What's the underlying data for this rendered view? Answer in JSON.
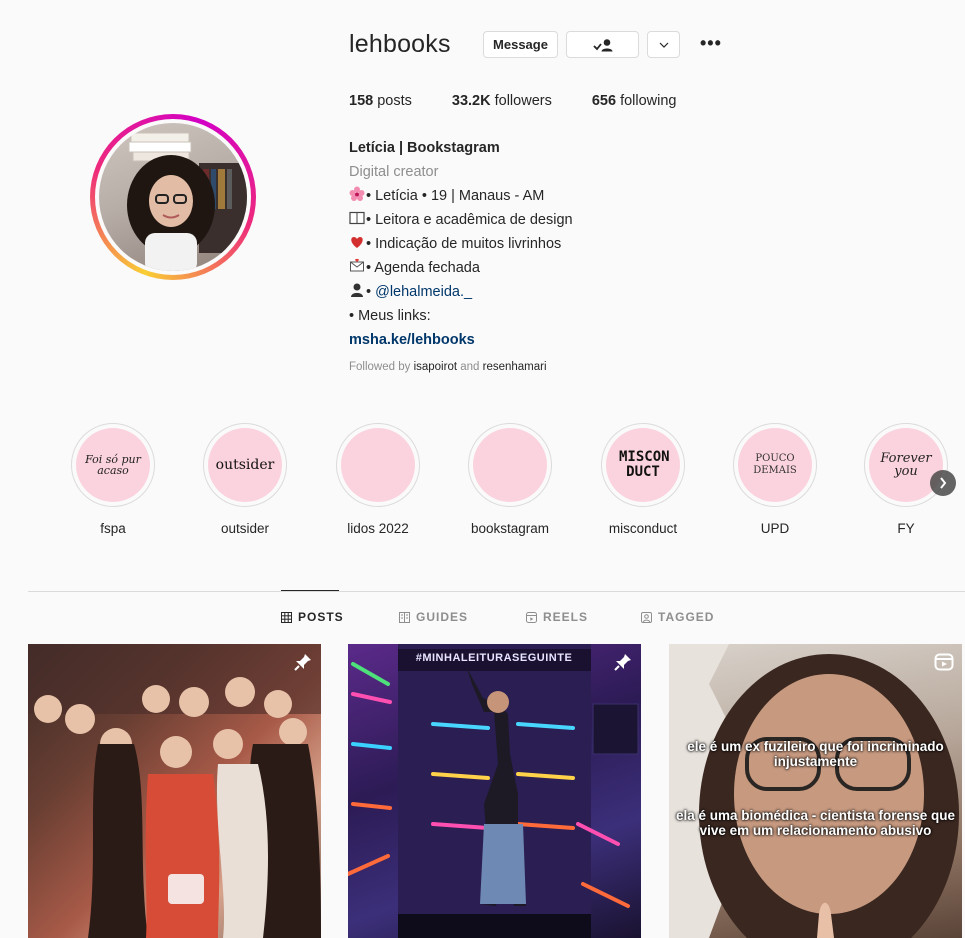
{
  "profile": {
    "username": "lehbooks",
    "buttons": {
      "message": "Message"
    },
    "stats": {
      "posts": "158",
      "posts_label": " posts",
      "followers": "33.2K",
      "followers_label": " followers",
      "following": "656",
      "following_label": " following"
    },
    "bio": {
      "name": "Letícia | Bookstagram",
      "category": "Digital creator",
      "line1": "• Letícia • 19 | Manaus - AM",
      "line2": "• Leitora e acadêmica de design",
      "line3": "• Indicação de muitos livrinhos",
      "line4": "• Agenda fechada",
      "line5_prefix": "• ",
      "mention": "@lehalmeida._",
      "line6": "• Meus links:",
      "link": "msha.ke/lehbooks"
    },
    "followed_by": {
      "prefix": "Followed by ",
      "user1": "isapoirot",
      "and": " and ",
      "user2": "resenhamari"
    }
  },
  "highlights": [
    {
      "label": "fspa",
      "cover_text": "Foi só pur acaso"
    },
    {
      "label": "outsider",
      "cover_text": "outsider"
    },
    {
      "label": "lidos 2022",
      "cover_text": ""
    },
    {
      "label": "bookstagram",
      "cover_text": ""
    },
    {
      "label": "misconduct",
      "cover_text": "MISCON DUCT"
    },
    {
      "label": "UPD",
      "cover_text": "POUCO DEMAIS"
    },
    {
      "label": "FY",
      "cover_text": "Forever you"
    }
  ],
  "tabs": [
    {
      "label": "POSTS",
      "icon": "grid-icon"
    },
    {
      "label": "GUIDES",
      "icon": "guide-icon"
    },
    {
      "label": "REELS",
      "icon": "reels-icon"
    },
    {
      "label": "TAGGED",
      "icon": "tagged-icon"
    }
  ],
  "posts": [
    {
      "icon": "pin-icon"
    },
    {
      "icon": "pin-icon",
      "sign": "#MINHALEITURASEGUINTE"
    },
    {
      "icon": "reel-icon",
      "caption1": "ele é um ex fuzileiro que foi incriminado injustamente",
      "caption2": "ela é uma biomédica - cientista forense que vive em um relacionamento abusivo"
    }
  ],
  "colors": {
    "link": "#00376b",
    "secondary": "#8e8e8e",
    "highlight_bg": "#fbd3de"
  }
}
